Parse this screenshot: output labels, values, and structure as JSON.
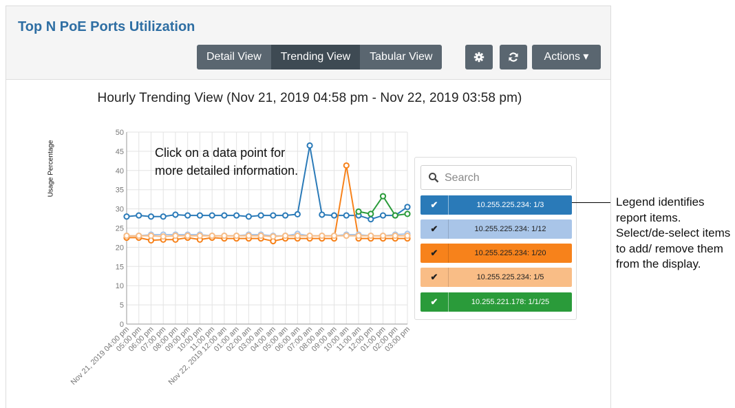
{
  "header": {
    "title": "Top N PoE Ports Utilization",
    "views": [
      {
        "label": "Detail View",
        "active": false
      },
      {
        "label": "Trending View",
        "active": true
      },
      {
        "label": "Tabular View",
        "active": false
      }
    ],
    "settings_icon": "gear-icon",
    "refresh_icon": "refresh-icon",
    "actions_label": "Actions ▾"
  },
  "annotation": "Click on a data point for more detailed information.",
  "callout": "Legend identifies report items. Select/de-select items to add/ remove them from the display.",
  "legend": {
    "search_placeholder": "Search",
    "items": [
      {
        "label": "10.255.225.234: 1/3",
        "color": "#2a7ab8",
        "text_color": "#ffffff",
        "checked": true
      },
      {
        "label": "10.255.225.234: 1/12",
        "color": "#a9c5e8",
        "text_color": "#222222",
        "checked": true
      },
      {
        "label": "10.255.225.234: 1/20",
        "color": "#f7821b",
        "text_color": "#222222",
        "checked": true
      },
      {
        "label": "10.255.225.234: 1/5",
        "color": "#f9bd86",
        "text_color": "#222222",
        "checked": true
      },
      {
        "label": "10.255.221.178: 1/1/25",
        "color": "#2a9b3a",
        "text_color": "#ffffff",
        "checked": true
      }
    ]
  },
  "chart_data": {
    "type": "line",
    "title": "Hourly Trending View (Nov 21, 2019 04:58 pm - Nov 22, 2019 03:58 pm)",
    "ylabel": "Usage Percentage",
    "xlabel": "",
    "ylim": [
      0,
      50
    ],
    "yticks": [
      0,
      5,
      10,
      15,
      20,
      25,
      30,
      35,
      40,
      45,
      50
    ],
    "grid": true,
    "categories": [
      "Nov 21, 2019 04:00 pm",
      "05:00 pm",
      "06:00 pm",
      "07:00 pm",
      "08:00 pm",
      "09:00 pm",
      "10:00 pm",
      "11:00 pm",
      "Nov 22, 2019 12:00 am",
      "01:00 am",
      "02:00 am",
      "03:00 am",
      "04:00 am",
      "05:00 am",
      "06:00 am",
      "07:00 am",
      "08:00 am",
      "09:00 am",
      "10:00 am",
      "11:00 am",
      "12:00 pm",
      "01:00 pm",
      "02:00 pm",
      "03:00 pm"
    ],
    "series": [
      {
        "name": "10.255.225.234: 1/3",
        "color": "#2a7ab8",
        "values": [
          28,
          28.3,
          28,
          28,
          28.5,
          28.3,
          28.3,
          28.3,
          28.3,
          28.3,
          28,
          28.3,
          28.3,
          28.3,
          28.6,
          46.5,
          28.5,
          28.3,
          28.3,
          28.3,
          27.3,
          28.3,
          28.3,
          30.5
        ]
      },
      {
        "name": "10.255.225.234: 1/12",
        "color": "#a9c5e8",
        "values": [
          23,
          23,
          23.3,
          23.3,
          23.3,
          23.3,
          23.3,
          23,
          23,
          23,
          23.3,
          23.3,
          23,
          23,
          23.5,
          23,
          23,
          23,
          23.3,
          23.3,
          23,
          23,
          23.3,
          23.5
        ]
      },
      {
        "name": "10.255.225.234: 1/20",
        "color": "#f7821b",
        "values": [
          22.5,
          22.5,
          21.8,
          22,
          22,
          22.5,
          22,
          22.5,
          22.3,
          22.3,
          22.3,
          22.3,
          21.6,
          22.3,
          22.3,
          22.3,
          22.3,
          22.3,
          41.3,
          22.3,
          22.3,
          22.3,
          22.3,
          22.3
        ]
      },
      {
        "name": "10.255.225.234: 1/5",
        "color": "#f9bd86",
        "values": [
          23,
          23,
          23,
          22.8,
          23,
          23,
          23,
          23,
          23,
          23,
          23,
          23,
          22.8,
          23,
          23,
          23,
          23,
          23,
          23,
          23,
          23,
          23,
          23,
          23
        ]
      },
      {
        "name": "10.255.221.178: 1/1/25",
        "color": "#2a9b3a",
        "values": [
          null,
          null,
          null,
          null,
          null,
          null,
          null,
          null,
          null,
          null,
          null,
          null,
          null,
          null,
          null,
          null,
          null,
          null,
          null,
          29.3,
          28.7,
          33.3,
          28.3,
          28.7
        ]
      }
    ]
  }
}
